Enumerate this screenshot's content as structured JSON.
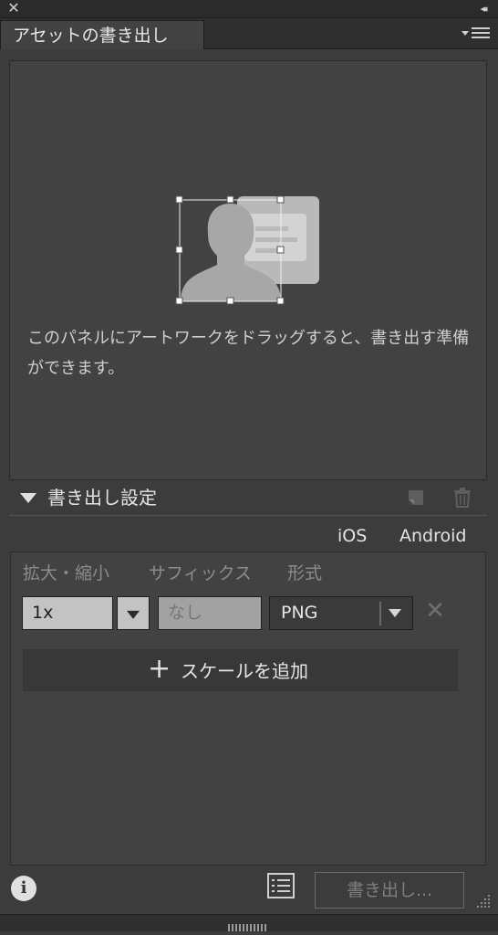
{
  "window": {
    "close_glyph": "✕",
    "collapse_glyph": "◂◂",
    "tab_title": "アセットの書き出し",
    "menu_icon": "panel-menu-icon"
  },
  "dropzone": {
    "illustration": "artwork-drag-placeholder-icon",
    "message": "このパネルにアートワークをドラッグすると、書き出す準備ができます。"
  },
  "export_settings": {
    "title": "書き出し設定",
    "platform_ios": "iOS",
    "platform_android": "Android",
    "col_scale": "拡大・縮小",
    "col_suffix": "サフィックス",
    "col_format": "形式",
    "row": {
      "scale_value": "1x",
      "suffix_placeholder": "なし",
      "format_value": "PNG",
      "remove_glyph": "✕"
    },
    "add_plus": "+",
    "add_label": "スケールを追加"
  },
  "footer": {
    "info_glyph": "i",
    "export_button": "書き出し..."
  },
  "colors": {
    "panel_bg": "#424242",
    "chrome_bg": "#2f2f2f",
    "field_bg": "#c3c3c3",
    "text": "#e6e6e6"
  }
}
